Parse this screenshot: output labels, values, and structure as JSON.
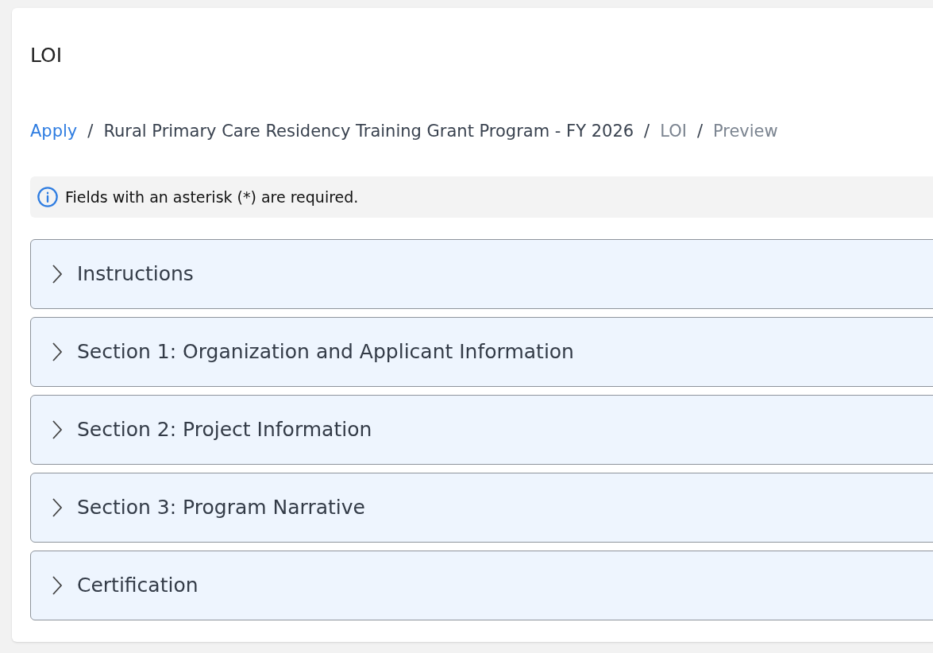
{
  "page_title": "LOI",
  "breadcrumb": [
    {
      "label": "Apply",
      "kind": "link"
    },
    {
      "label": "/",
      "kind": "separator"
    },
    {
      "label": "Rural Primary Care Residency Training Grant Program - FY 2026",
      "kind": "page"
    },
    {
      "label": "/",
      "kind": "separator"
    },
    {
      "label": "LOI",
      "kind": "muted"
    },
    {
      "label": "/",
      "kind": "separator"
    },
    {
      "label": "Preview",
      "kind": "muted"
    }
  ],
  "notice": "Fields with an asterisk (*) are required.",
  "sections": [
    {
      "title": "Instructions",
      "expanded": false
    },
    {
      "title": "Section 1: Organization and Applicant Information",
      "expanded": false
    },
    {
      "title": "Section 2: Project Information",
      "expanded": false
    },
    {
      "title": "Section 3: Program Narrative",
      "expanded": false
    },
    {
      "title": "Certification",
      "expanded": false
    }
  ]
}
